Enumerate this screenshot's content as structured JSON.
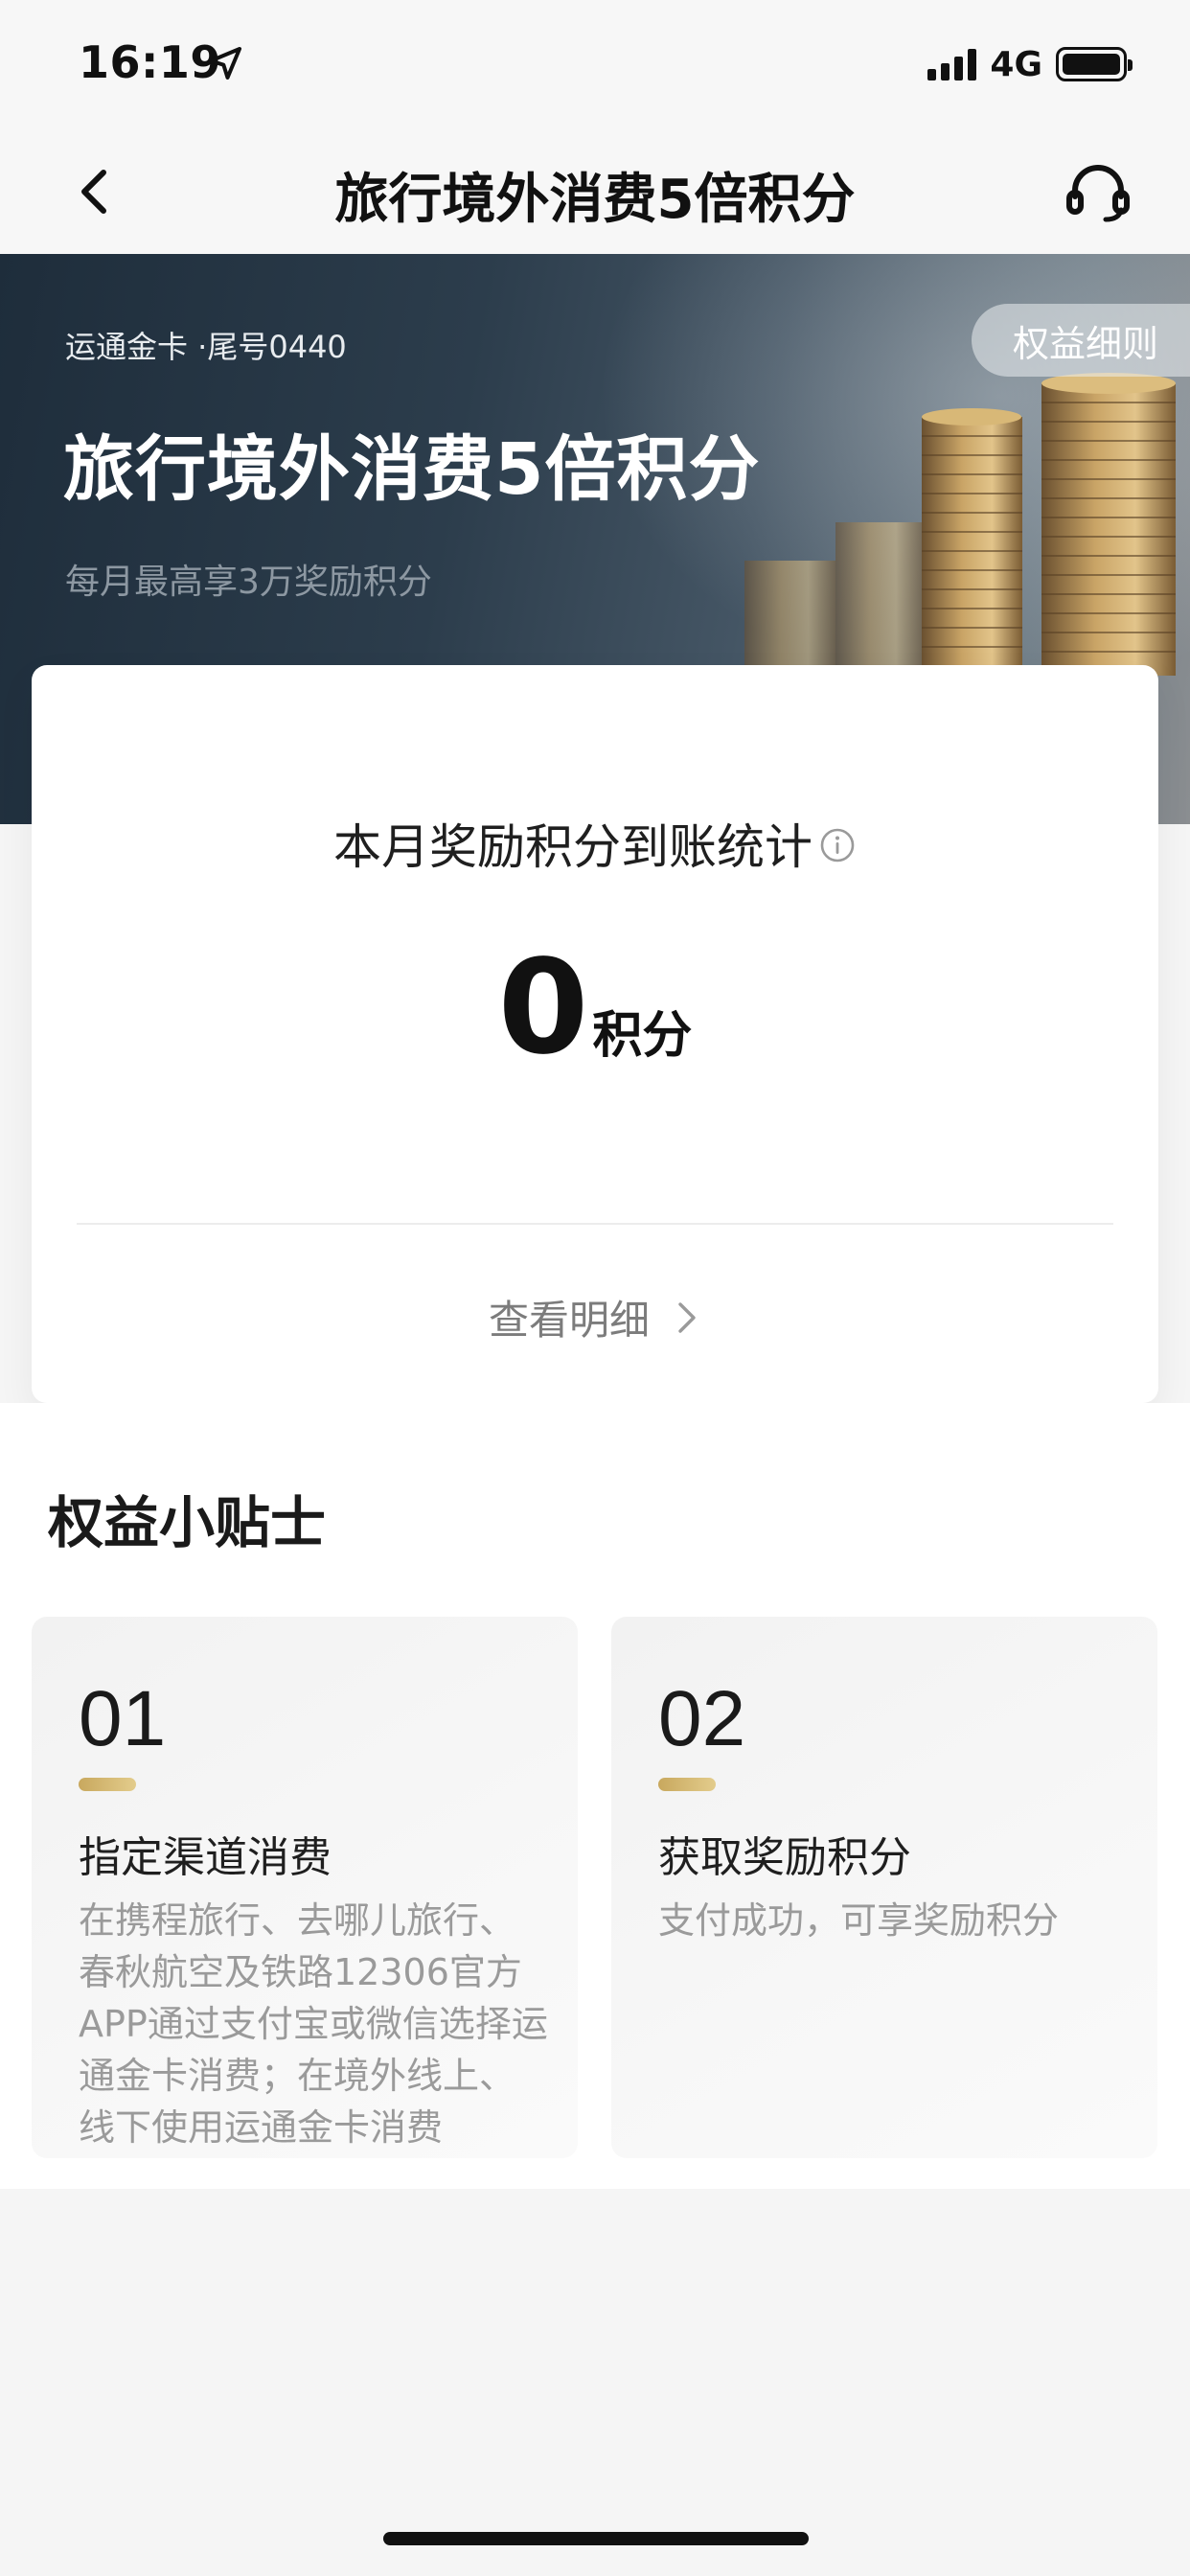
{
  "status_bar": {
    "time": "16:19",
    "network": "4G",
    "location_icon": "location-arrow-icon",
    "signal_icon": "signal-bars-icon",
    "battery_icon": "battery-icon",
    "battery_level": 0.9
  },
  "nav": {
    "title": "旅行境外消费5倍积分",
    "back_icon": "chevron-left-icon",
    "service_icon": "headset-icon"
  },
  "hero": {
    "card_number": "运通金卡 ·尾号0440",
    "title": "旅行境外消费5倍积分",
    "subtitle": "每月最高享3万奖励积分",
    "rules_button": "权益细则"
  },
  "stats": {
    "title": "本月奖励积分到账统计",
    "info_icon": "info-circle-icon",
    "points_value": "0",
    "points_unit": "积分",
    "detail_link": "查看明细",
    "detail_icon": "chevron-right-icon"
  },
  "tips": {
    "heading": "权益小贴士",
    "items": [
      {
        "number": "01",
        "title": "指定渠道消费",
        "description": "在携程旅行、去哪儿旅行、春秋航空及铁路12306官方APP通过支付宝或微信选择运通金卡消费；在境外线上、线下使用运通金卡消费"
      },
      {
        "number": "02",
        "title": "获取奖励积分",
        "description": "支付成功，可享奖励积分"
      }
    ]
  },
  "colors": {
    "accent_gold": "#c8a85e",
    "hero_dark": "#1e2d3b",
    "muted_text": "#9a9a9a"
  }
}
